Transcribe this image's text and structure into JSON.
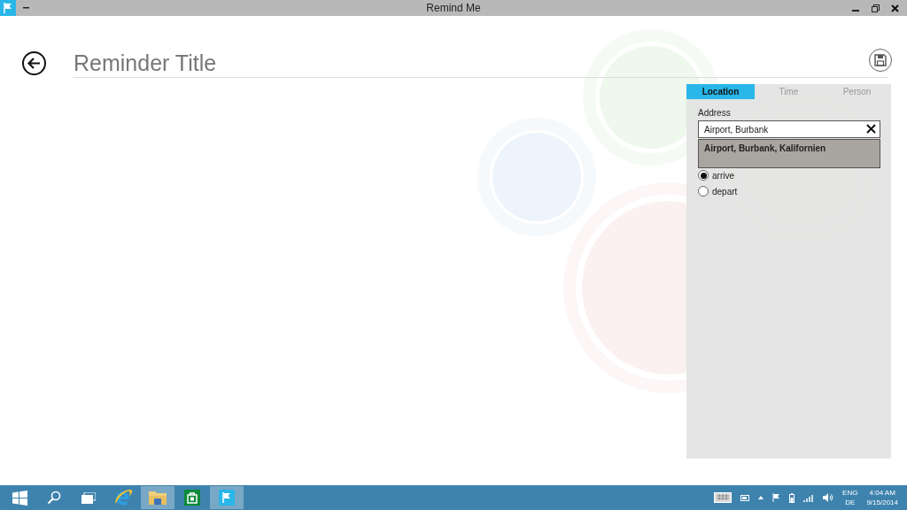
{
  "window": {
    "title": "Remind Me"
  },
  "title_field": {
    "placeholder": "Reminder Title"
  },
  "panel": {
    "tabs": [
      {
        "label": "Location",
        "selected": true
      },
      {
        "label": "Time",
        "selected": false
      },
      {
        "label": "Person",
        "selected": false
      }
    ],
    "address": {
      "label": "Address",
      "value": "Airport, Burbank"
    },
    "suggestions": [
      "Airport, Burbank, Kalifornien"
    ],
    "options": [
      {
        "label": "arrive",
        "selected": true
      },
      {
        "label": "depart",
        "selected": false
      }
    ]
  },
  "taskbar": {
    "apps": [
      {
        "kind": "start",
        "active": false
      },
      {
        "kind": "search",
        "active": false
      },
      {
        "kind": "taskview",
        "active": false
      },
      {
        "kind": "browser",
        "active": false
      },
      {
        "kind": "explorer",
        "active": true
      },
      {
        "kind": "store",
        "active": false
      },
      {
        "kind": "remind",
        "active": true
      }
    ],
    "language": "ENG",
    "layout": "DE",
    "time": "4:04 AM",
    "date": "9/15/2014"
  }
}
